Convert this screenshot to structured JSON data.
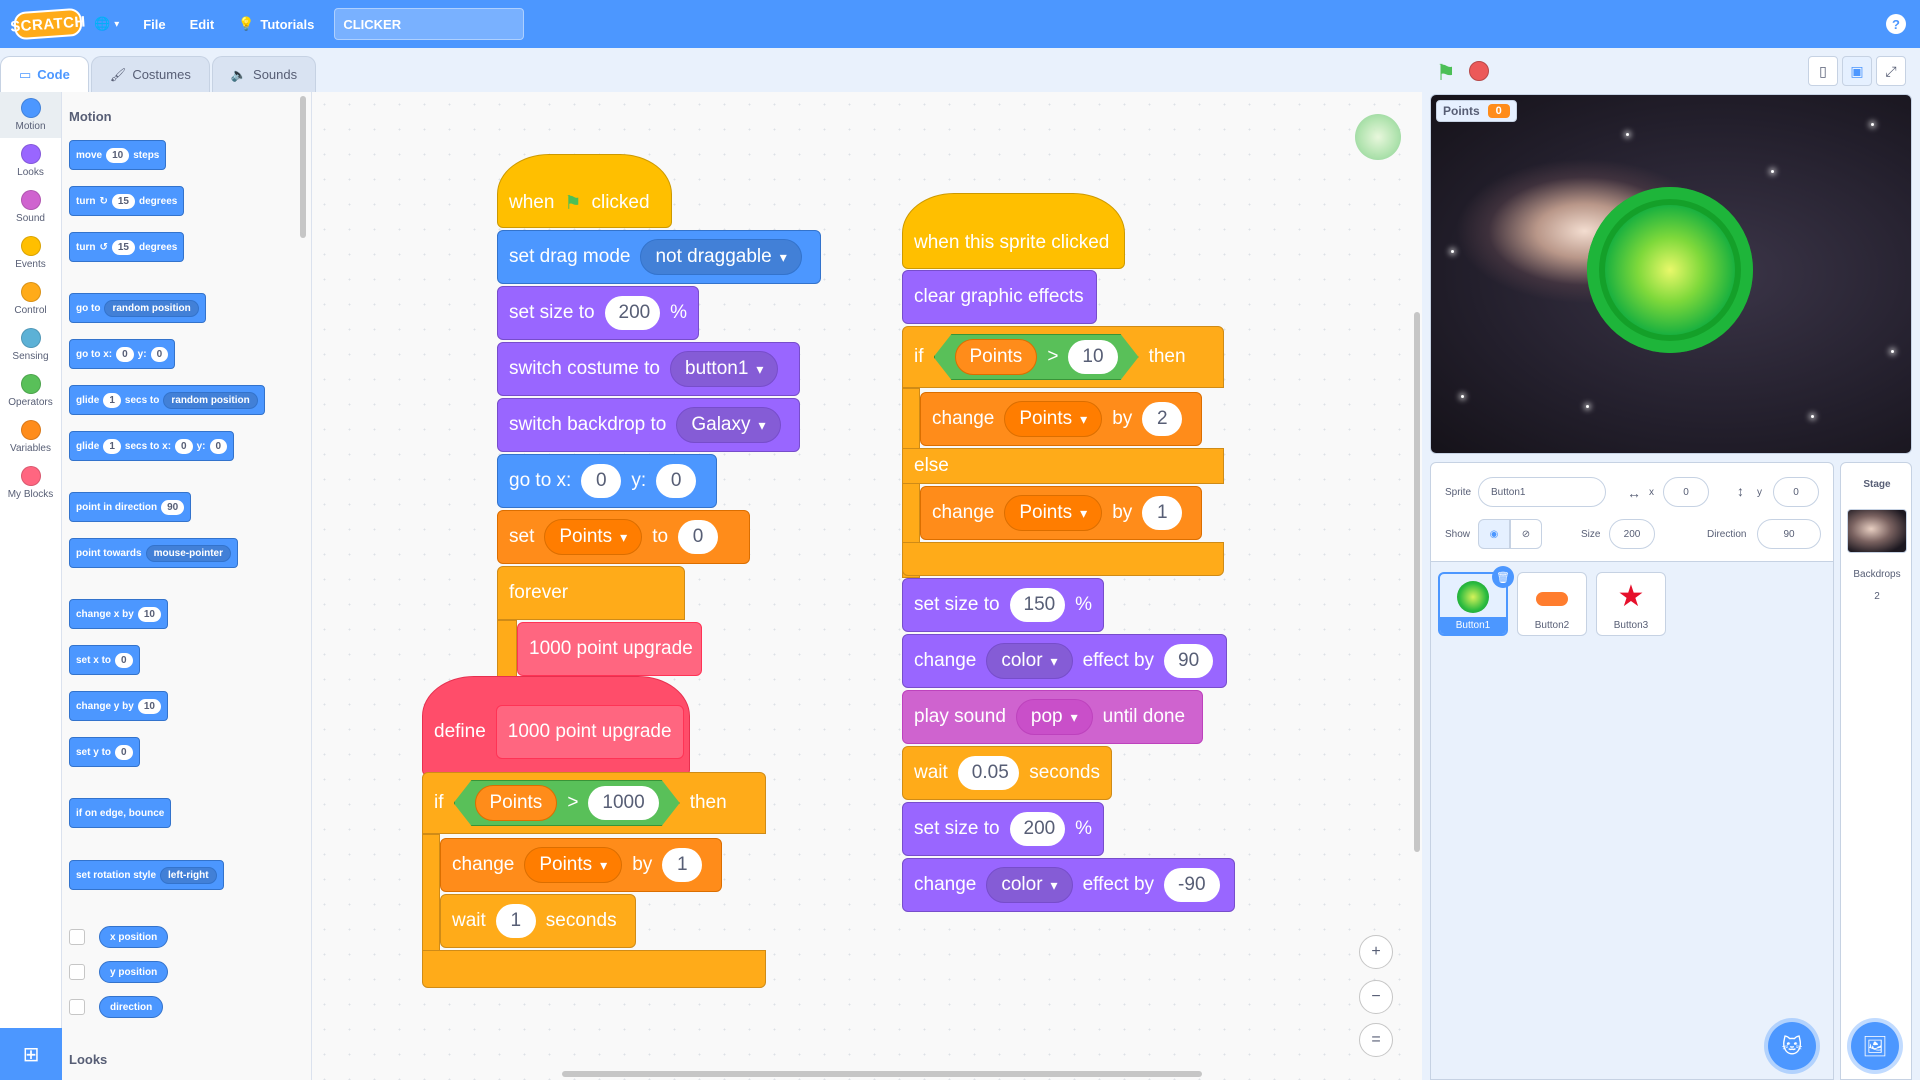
{
  "menubar": {
    "logo": "SCRATCH",
    "file": "File",
    "edit": "Edit",
    "tutorials": "Tutorials",
    "project_title": "CLICKER",
    "help": "?"
  },
  "tabs": [
    {
      "label": "Code"
    },
    {
      "label": "Costumes"
    },
    {
      "label": "Sounds"
    }
  ],
  "categories": [
    {
      "label": "Motion",
      "color": "#4c97ff"
    },
    {
      "label": "Looks",
      "color": "#9966ff"
    },
    {
      "label": "Sound",
      "color": "#cf63cf"
    },
    {
      "label": "Events",
      "color": "#ffbf00"
    },
    {
      "label": "Control",
      "color": "#ffab19"
    },
    {
      "label": "Sensing",
      "color": "#5cb1d6"
    },
    {
      "label": "Operators",
      "color": "#59c059"
    },
    {
      "label": "Variables",
      "color": "#ff8c1a"
    },
    {
      "label": "My Blocks",
      "color": "#ff6680"
    }
  ],
  "palette": {
    "heading": "Motion",
    "move": "move",
    "move_n": "10",
    "steps": "steps",
    "turn": "turn",
    "turn_r": "15",
    "turn_l": "15",
    "degrees": "degrees",
    "goto": "go to",
    "goto_dd": "random position",
    "gotoxy": "go to x:",
    "x0": "0",
    "y": "y:",
    "y0": "0",
    "glide": "glide",
    "glide_n": "1",
    "secs_to": "secs to",
    "glide_dd": "random position",
    "glide2": "glide",
    "glide2_n": "1",
    "secs_to_x": "secs to x:",
    "gx": "0",
    "gy_lbl": "y:",
    "gy": "0",
    "point_dir": "point in direction",
    "dir_n": "90",
    "point_towards": "point towards",
    "towards_dd": "mouse-pointer",
    "change_x": "change x by",
    "cx": "10",
    "set_x": "set x to",
    "sx": "0",
    "change_y": "change y by",
    "cy": "10",
    "set_y": "set y to",
    "sy": "0",
    "bounce": "if on edge, bounce",
    "rot_style": "set rotation style",
    "rot_dd": "left-right",
    "xpos": "x position",
    "ypos": "y position",
    "direction": "direction",
    "looks_heading": "Looks"
  },
  "script1": {
    "when": "when",
    "clicked": "clicked",
    "drag": "set drag mode",
    "drag_dd": "not draggable",
    "size": "set size to",
    "size_n": "200",
    "pct": "%",
    "costume": "switch costume to",
    "costume_dd": "button1",
    "backdrop": "switch backdrop to",
    "backdrop_dd": "Galaxy",
    "goto": "go to x:",
    "gx": "0",
    "gy_lbl": "y:",
    "gy": "0",
    "set": "set",
    "set_var": "Points",
    "to": "to",
    "set_val": "0",
    "forever": "forever",
    "call": "1000 point upgrade"
  },
  "script2": {
    "define": "define",
    "proc": "1000 point upgrade",
    "if": "if",
    "var": "Points",
    "gt": ">",
    "cmp": "1000",
    "then": "then",
    "change": "change",
    "ch_var": "Points",
    "by": "by",
    "ch_n": "1",
    "wait": "wait",
    "wait_n": "1",
    "seconds": "seconds"
  },
  "script3": {
    "hat": "when this sprite clicked",
    "clear": "clear graphic effects",
    "if": "if",
    "var": "Points",
    "gt": ">",
    "cmp": "10",
    "then": "then",
    "change1": "change",
    "ch1_var": "Points",
    "by1": "by",
    "ch1_n": "2",
    "else": "else",
    "change2": "change",
    "ch2_var": "Points",
    "by2": "by",
    "ch2_n": "1",
    "size1": "set size to",
    "size1_n": "150",
    "pct1": "%",
    "effect1": "change",
    "eff1_dd": "color",
    "eff1_by": "effect by",
    "eff1_n": "90",
    "sound": "play sound",
    "sound_dd": "pop",
    "until": "until done",
    "wait": "wait",
    "wait_n": "0.05",
    "seconds": "seconds",
    "size2": "set size to",
    "size2_n": "200",
    "pct2": "%",
    "effect2": "change",
    "eff2_dd": "color",
    "eff2_by": "effect by",
    "eff2_n": "-90"
  },
  "zoom": {
    "in": "+",
    "out": "−",
    "reset": "="
  },
  "stage": {
    "monitor_label": "Points",
    "monitor_value": "0"
  },
  "sprite_info": {
    "sprite_lbl": "Sprite",
    "sprite_name": "Button1",
    "x_lbl": "x",
    "x": "0",
    "y_lbl": "y",
    "y": "0",
    "show_lbl": "Show",
    "size_lbl": "Size",
    "size": "200",
    "dir_lbl": "Direction",
    "dir": "90"
  },
  "sprites": [
    {
      "name": "Button1"
    },
    {
      "name": "Button2"
    },
    {
      "name": "Button3"
    }
  ],
  "stage_pane": {
    "title": "Stage",
    "backdrops_lbl": "Backdrops",
    "backdrops_n": "2"
  }
}
